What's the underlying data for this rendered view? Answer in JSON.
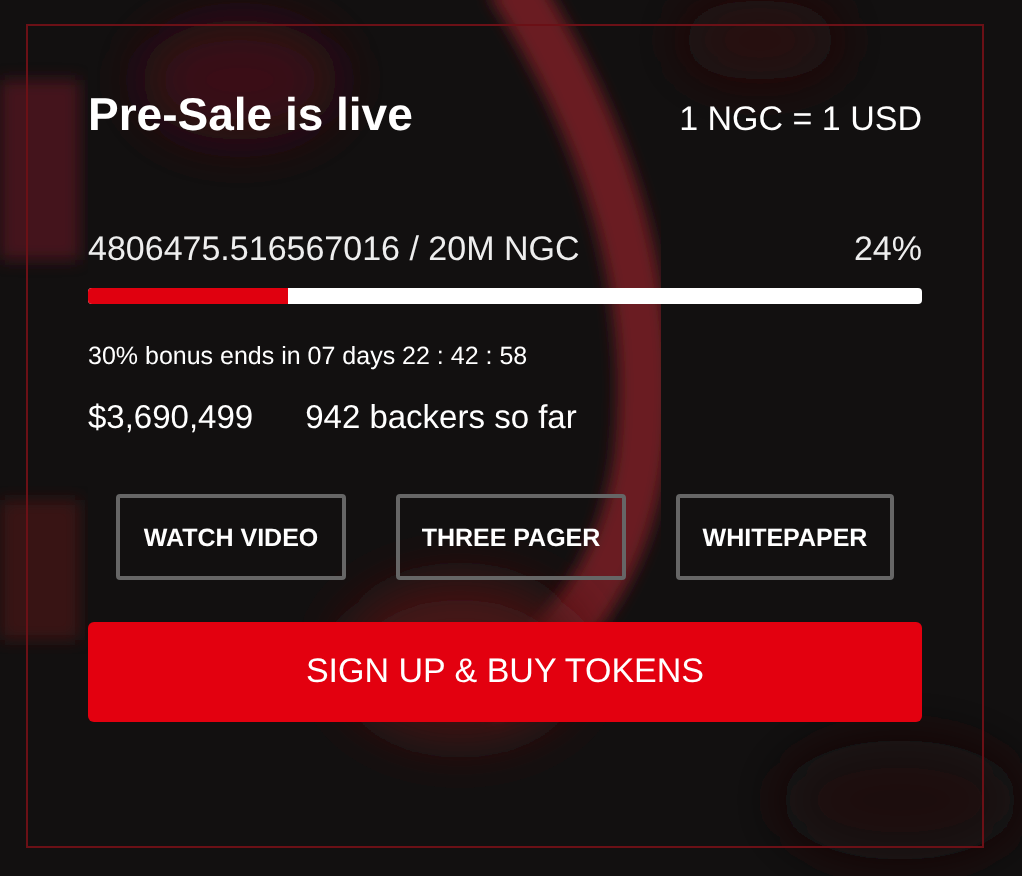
{
  "presale": {
    "title": "Pre-Sale is live",
    "rate": "1 NGC = 1 USD",
    "raised": "4806475.516567016 / 20M NGC",
    "percent": "24%",
    "level": 0.24,
    "bonus": "30% bonus ends in 07 days 22 : 42 : 58",
    "amount": "$3,690,499",
    "backers": "942 backers so far"
  },
  "links": [
    "WATCH VIDEO",
    "THREE PAGER",
    "WHITEPAPER"
  ],
  "cta": "SIGN UP & BUY TOKENS"
}
